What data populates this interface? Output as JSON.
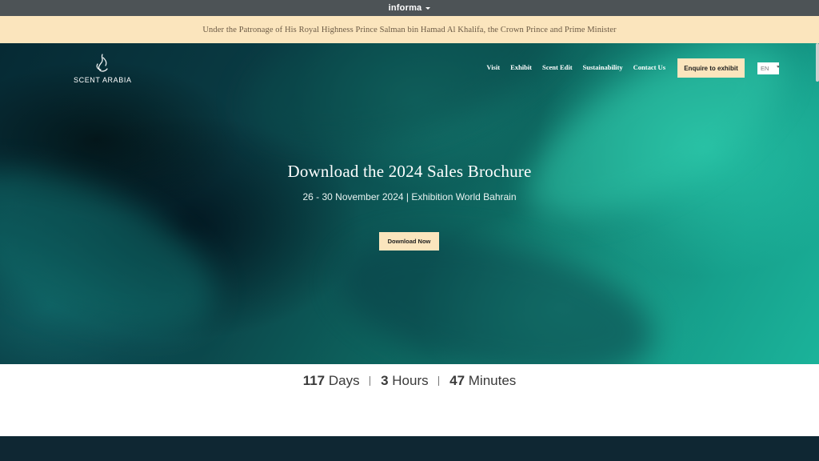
{
  "topbar": {
    "brand": "informa"
  },
  "banner": {
    "text": "Under the Patronage of His Royal Highness Prince Salman bin Hamad Al Khalifa, the Crown Prince and Prime Minister"
  },
  "header": {
    "logo_text": "SCENT ARABIA",
    "nav": [
      "Visit",
      "Exhibit",
      "Scent Edit",
      "Sustainability",
      "Contact Us"
    ],
    "enquire_label": "Enquire to exhibit",
    "language": "EN"
  },
  "hero": {
    "title": "Download the 2024 Sales Brochure",
    "subtitle": "26 - 30 November 2024 | Exhibition World Bahrain",
    "cta_label": "Download Now"
  },
  "countdown": {
    "days_value": "117",
    "days_label": "Days",
    "hours_value": "3",
    "hours_label": "Hours",
    "minutes_value": "47",
    "minutes_label": "Minutes"
  },
  "colors": {
    "accent": "#fbe5bd",
    "topbar": "#4d5356",
    "footer": "#0f2733"
  }
}
